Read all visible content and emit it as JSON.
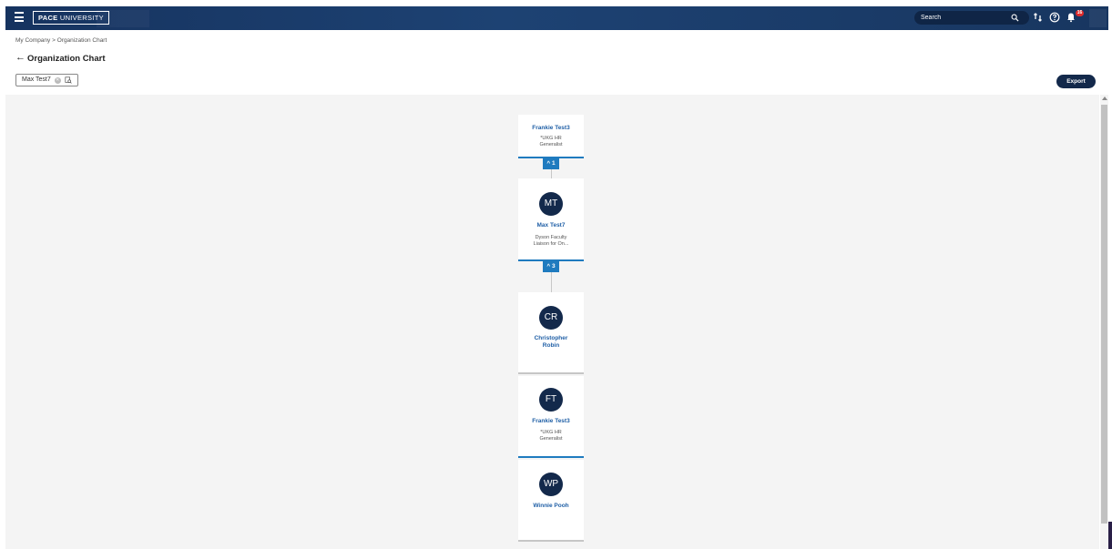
{
  "topbar": {
    "logo_bold": "PACE",
    "logo_rest": " UNIVERSITY",
    "search_placeholder": "Search",
    "notification_count": "16"
  },
  "breadcrumb": {
    "root": "My Company",
    "separator": ">",
    "current": "Organization Chart"
  },
  "page_title": "Organization Chart",
  "filter_chip": {
    "label": "Max Test7"
  },
  "export_label": "Export",
  "org": {
    "manager": {
      "name": "Frankie Test3",
      "title": "*UKG HR Generalist",
      "title_l1": "*UKG HR",
      "title_l2": "Generalist",
      "toggle": "1"
    },
    "focus": {
      "initials": "MT",
      "name": "Max Test7",
      "title_l1": "Dyson Faculty",
      "title_l2": "Liaison for On...",
      "toggle": "3"
    },
    "reports": [
      {
        "initials": "CR",
        "name_l1": "Christopher",
        "name_l2": "Robin"
      },
      {
        "initials": "FT",
        "name": "Frankie Test3",
        "title_l1": "*UKG HR",
        "title_l2": "Generalist"
      },
      {
        "initials": "WP",
        "name": "Winnie Pooh"
      }
    ]
  },
  "colors": {
    "topbar": "#1d4273",
    "accent": "#1f7bbf",
    "avatar": "#13294b",
    "name_link": "#1f5fa6"
  }
}
